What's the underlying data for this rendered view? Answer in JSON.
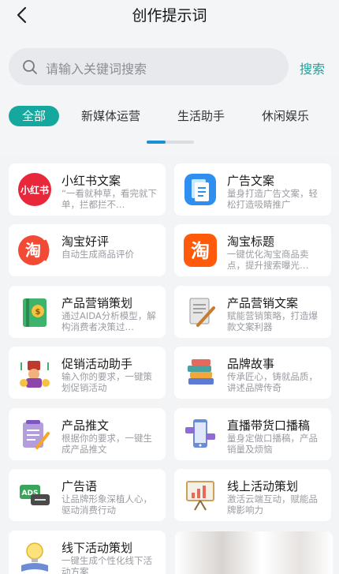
{
  "header": {
    "title": "创作提示词"
  },
  "search": {
    "placeholder": "请输入关键词搜索",
    "button_label": "搜索"
  },
  "tabs": [
    {
      "label": "全部",
      "active": true
    },
    {
      "label": "新媒体运营",
      "active": false
    },
    {
      "label": "生活助手",
      "active": false
    },
    {
      "label": "休闲娱乐",
      "active": false
    }
  ],
  "colors": {
    "accent": "#14a89e",
    "indicator": "#1a8fd6"
  },
  "items": [
    {
      "name": "小红书文案",
      "desc": "“一看就种草，看完就下单，拦都拦不…",
      "icon": "xiaohongshu-logo-icon"
    },
    {
      "name": "广告文案",
      "desc": "量身打造广告文案，轻松打造吸睛推广",
      "icon": "document-icon"
    },
    {
      "name": "淘宝好评",
      "desc": "自动生成商品评价",
      "icon": "taobao-logo-icon"
    },
    {
      "name": "淘宝标题",
      "desc": "一键优化淘宝商品卖点，提升搜索曝光…",
      "icon": "taobao-logo-icon"
    },
    {
      "name": "产品营销策划",
      "desc": "通过AIDA分析模型，解构消费者决策过…",
      "icon": "money-book-icon"
    },
    {
      "name": "产品营销文案",
      "desc": "赋能营销策略，打造爆款文案利器",
      "icon": "paper-pen-icon"
    },
    {
      "name": "促销活动助手",
      "desc": "输入你的要求，一键策划促销活动",
      "icon": "promotion-icon"
    },
    {
      "name": "品牌故事",
      "desc": "传承匠心，铸就品质，讲述品牌传奇",
      "icon": "books-stack-icon"
    },
    {
      "name": "产品推文",
      "desc": "根据你的要求，一键生成产品推文",
      "icon": "notepad-pen-icon"
    },
    {
      "name": "直播带货口播稿",
      "desc": "量身定做口播稿，产品销量及烦恼",
      "icon": "live-phone-icon"
    },
    {
      "name": "广告语",
      "desc": "让品牌形象深植人心，驱动消费行动",
      "icon": "ads-chat-icon"
    },
    {
      "name": "线上活动策划",
      "desc": "激活云端互动，赋能品牌影响力",
      "icon": "presentation-board-icon"
    },
    {
      "name": "线下活动策划",
      "desc": "一键生成个性化线下活动方案",
      "icon": "lightbulb-book-icon"
    }
  ]
}
